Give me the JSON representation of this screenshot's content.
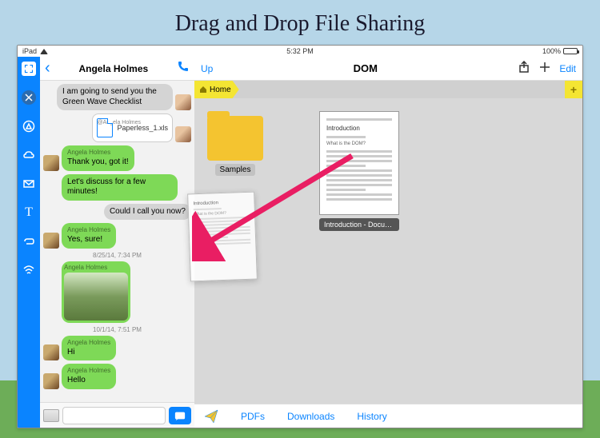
{
  "page_title": "Drag and Drop File Sharing",
  "statusbar": {
    "device": "iPad",
    "time": "5:32 PM",
    "battery": "100%"
  },
  "sidebar": {
    "icons": [
      "expand-icon",
      "close-icon",
      "compass-icon",
      "cloud-icon",
      "mail-icon",
      "text-icon",
      "staple-icon",
      "wifi-icon"
    ]
  },
  "chat": {
    "title": "Angela Holmes",
    "messages": [
      {
        "type": "out",
        "text": "I am going to send you the Green Wave Checklist"
      },
      {
        "type": "file",
        "sender": "@Angela Holmes",
        "filename": "Paperless_1.xls"
      },
      {
        "type": "in",
        "sender": "Angela Holmes",
        "text": "Thank you,  got it!"
      },
      {
        "type": "in",
        "text": "Let's discuss for a few minutes!"
      },
      {
        "type": "out",
        "text": "Could I call you now?"
      },
      {
        "type": "in",
        "sender": "Angela Holmes",
        "text": "Yes, sure!"
      },
      {
        "type": "timestamp",
        "text": "8/25/14, 7:34 PM"
      },
      {
        "type": "photo",
        "sender": "Angela Holmes"
      },
      {
        "type": "timestamp",
        "text": "10/1/14, 7:51 PM"
      },
      {
        "type": "in",
        "sender": "Angela Holmes",
        "text": "Hi"
      },
      {
        "type": "in",
        "sender": "Angela Holmes",
        "text": "Hello"
      }
    ]
  },
  "filepane": {
    "up": "Up",
    "title": "DOM",
    "edit": "Edit",
    "breadcrumb_home": "Home",
    "folder": "Samples",
    "doc_title": "Introduction",
    "doc_sub": "What is the DOM?",
    "doc_label": "Introduction - Document Object...",
    "footer": {
      "pdfs": "PDFs",
      "downloads": "Downloads",
      "history": "History"
    }
  },
  "drag_ghost": {
    "title": "Introduction",
    "sub": "What is the DOM?"
  }
}
